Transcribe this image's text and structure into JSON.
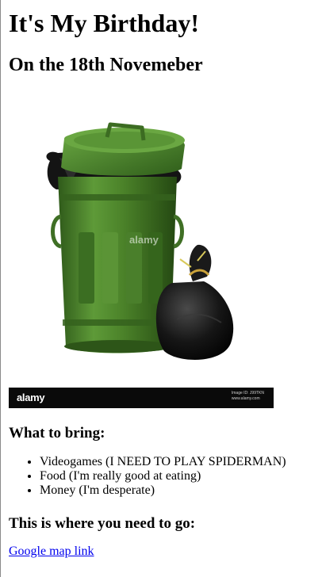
{
  "page": {
    "title": "It's My Birthday!",
    "date_heading": "On the 18th Novemeber"
  },
  "photo": {
    "description_icon": "green-trash-can-with-garbage-bags",
    "watermark": "alamy",
    "stock_bar": {
      "logo": "alamy",
      "image_id": "Image ID: J99TKN",
      "site": "www.alamy.com"
    }
  },
  "bring": {
    "heading": "What to bring:",
    "items": [
      "Videogames (I NEED TO PLAY SPIDERMAN)",
      "Food (I'm really good at eating)",
      "Money (I'm desperate)"
    ]
  },
  "location": {
    "heading": "This is where you need to go:",
    "link_text": "Google map link"
  },
  "colors": {
    "link": "#0000ee",
    "can_green": "#4f8a2f",
    "bag_black": "#111111"
  }
}
